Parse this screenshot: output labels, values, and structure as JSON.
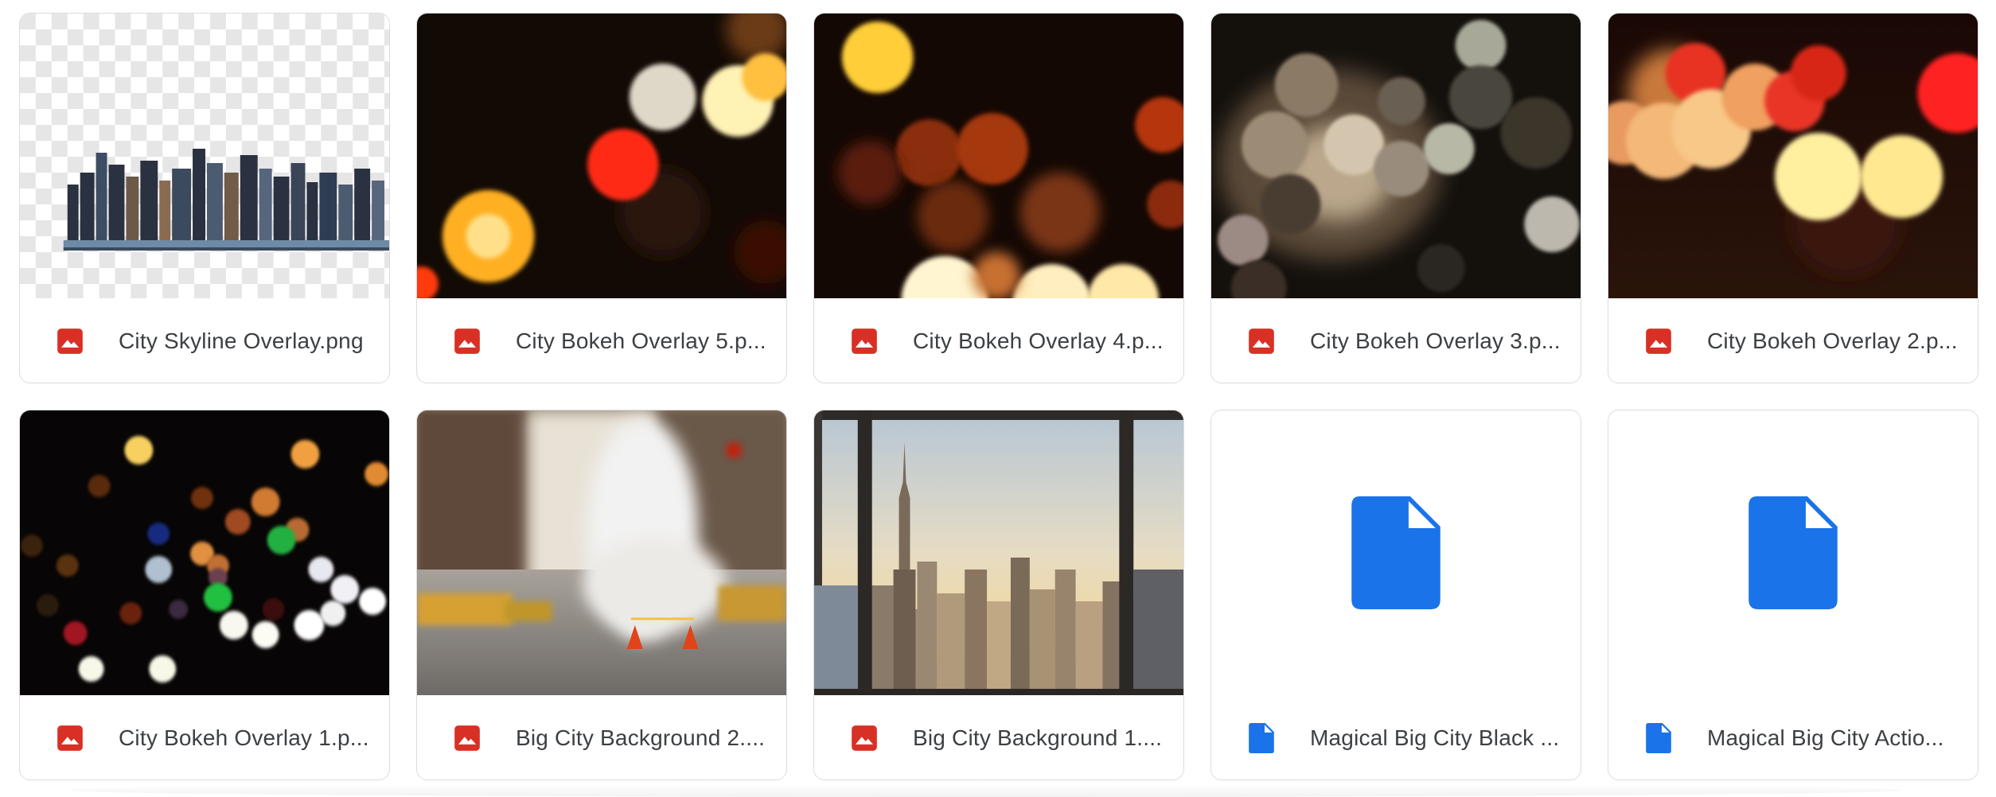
{
  "files": [
    {
      "name": "City Skyline Overlay.png",
      "type": "image",
      "icon": "image-icon"
    },
    {
      "name": "City Bokeh Overlay 5.p...",
      "type": "image",
      "icon": "image-icon"
    },
    {
      "name": "City Bokeh Overlay 4.p...",
      "type": "image",
      "icon": "image-icon"
    },
    {
      "name": "City Bokeh Overlay 3.p...",
      "type": "image",
      "icon": "image-icon"
    },
    {
      "name": "City Bokeh Overlay 2.p...",
      "type": "image",
      "icon": "image-icon"
    },
    {
      "name": "City Bokeh Overlay 1.p...",
      "type": "image",
      "icon": "image-icon"
    },
    {
      "name": "Big City Background 2....",
      "type": "image",
      "icon": "image-icon"
    },
    {
      "name": "Big City Background 1....",
      "type": "image",
      "icon": "image-icon"
    },
    {
      "name": "Magical Big City Black ...",
      "type": "document",
      "icon": "document-icon"
    },
    {
      "name": "Magical Big City Actio...",
      "type": "document",
      "icon": "document-icon"
    }
  ],
  "colors": {
    "image_icon": "#d93025",
    "document_icon": "#1a73e8",
    "card_border": "#dadce0",
    "text": "#3c4043"
  }
}
